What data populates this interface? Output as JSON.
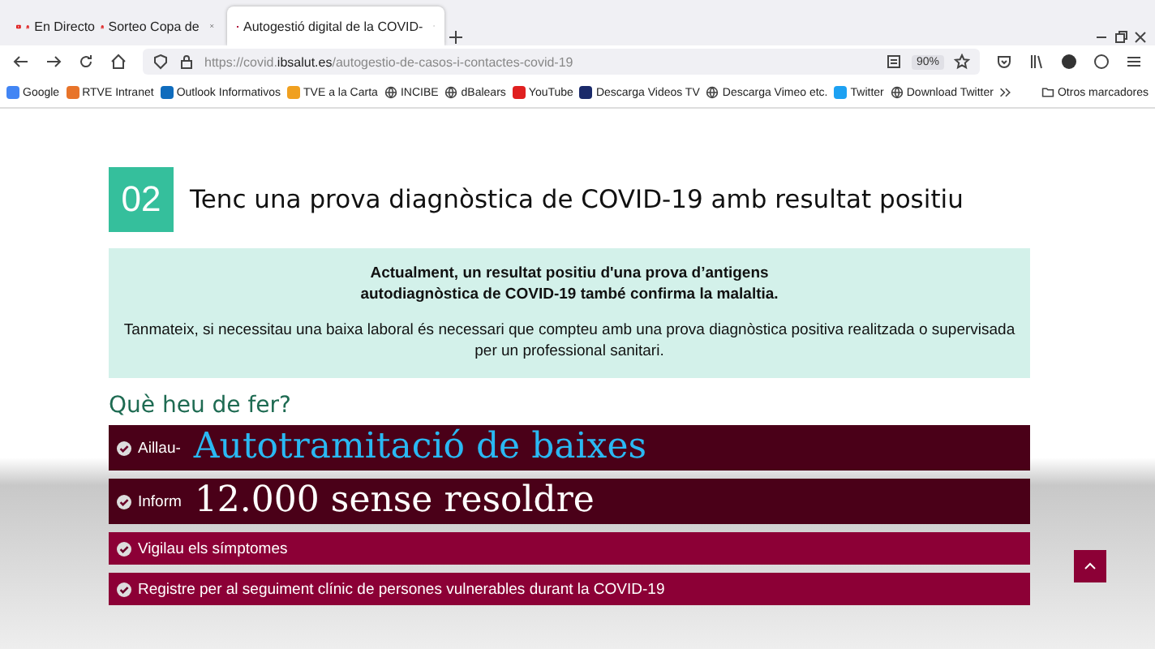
{
  "browser": {
    "tabs": [
      {
        "parts": [
          "En Directo",
          "Sorteo Copa de"
        ],
        "kind": "video",
        "selected": false
      },
      {
        "parts": [
          "Autogestió digital de la COVID-"
        ],
        "kind": "health",
        "selected": true
      }
    ],
    "url": {
      "prefix": "https://covid.",
      "domain": "ibsalut.es",
      "path": "/autogestio-de-casos-i-contactes-covid-19"
    },
    "zoom": "90%",
    "bookmarks": [
      {
        "label": "Google",
        "kind": "favicon",
        "color": "#4285f4"
      },
      {
        "label": "RTVE Intranet",
        "kind": "favicon",
        "color": "#e8742a"
      },
      {
        "label": "Outlook Informativos",
        "kind": "favicon",
        "color": "#0f6cbd"
      },
      {
        "label": "TVE a la Carta",
        "kind": "favicon",
        "color": "#f0a020"
      },
      {
        "label": "INCIBE",
        "kind": "globe"
      },
      {
        "label": "dBalears",
        "kind": "globe"
      },
      {
        "label": "YouTube",
        "kind": "favicon",
        "color": "#e02020"
      },
      {
        "label": "Descarga Videos TV",
        "kind": "favicon",
        "color": "#1a2a6a"
      },
      {
        "label": "Descarga Vimeo etc.",
        "kind": "globe"
      },
      {
        "label": "Twitter",
        "kind": "favicon",
        "color": "#1da1f2"
      },
      {
        "label": "Download Twitter",
        "kind": "globe"
      }
    ],
    "more_bookmarks": "Otros marcadores"
  },
  "page": {
    "step": "02",
    "heading": "Tenc una prova diagnòstica de COVID-19 amb resultat positiu",
    "notice": [
      "Actualment, un resultat positiu d'una prova d’antigens",
      "autodiagnòstica de COVID-19 també confirma la malaltia."
    ],
    "info": "Tanmateix, si necessitau una baixa laboral és necessari que compteu amb una prova diagnòstica positiva realitzada o supervisada per un professional sanitari.",
    "section": "Què heu de fer?",
    "actions": [
      "Aillau-",
      "Inform",
      "Vigilau els símptomes",
      "Registre per al seguiment clínic de persones vulnerables durant la COVID-19"
    ]
  },
  "caption": {
    "title": "Autotramitació de baixes",
    "subtitle": "12.000 sense resoldre"
  }
}
